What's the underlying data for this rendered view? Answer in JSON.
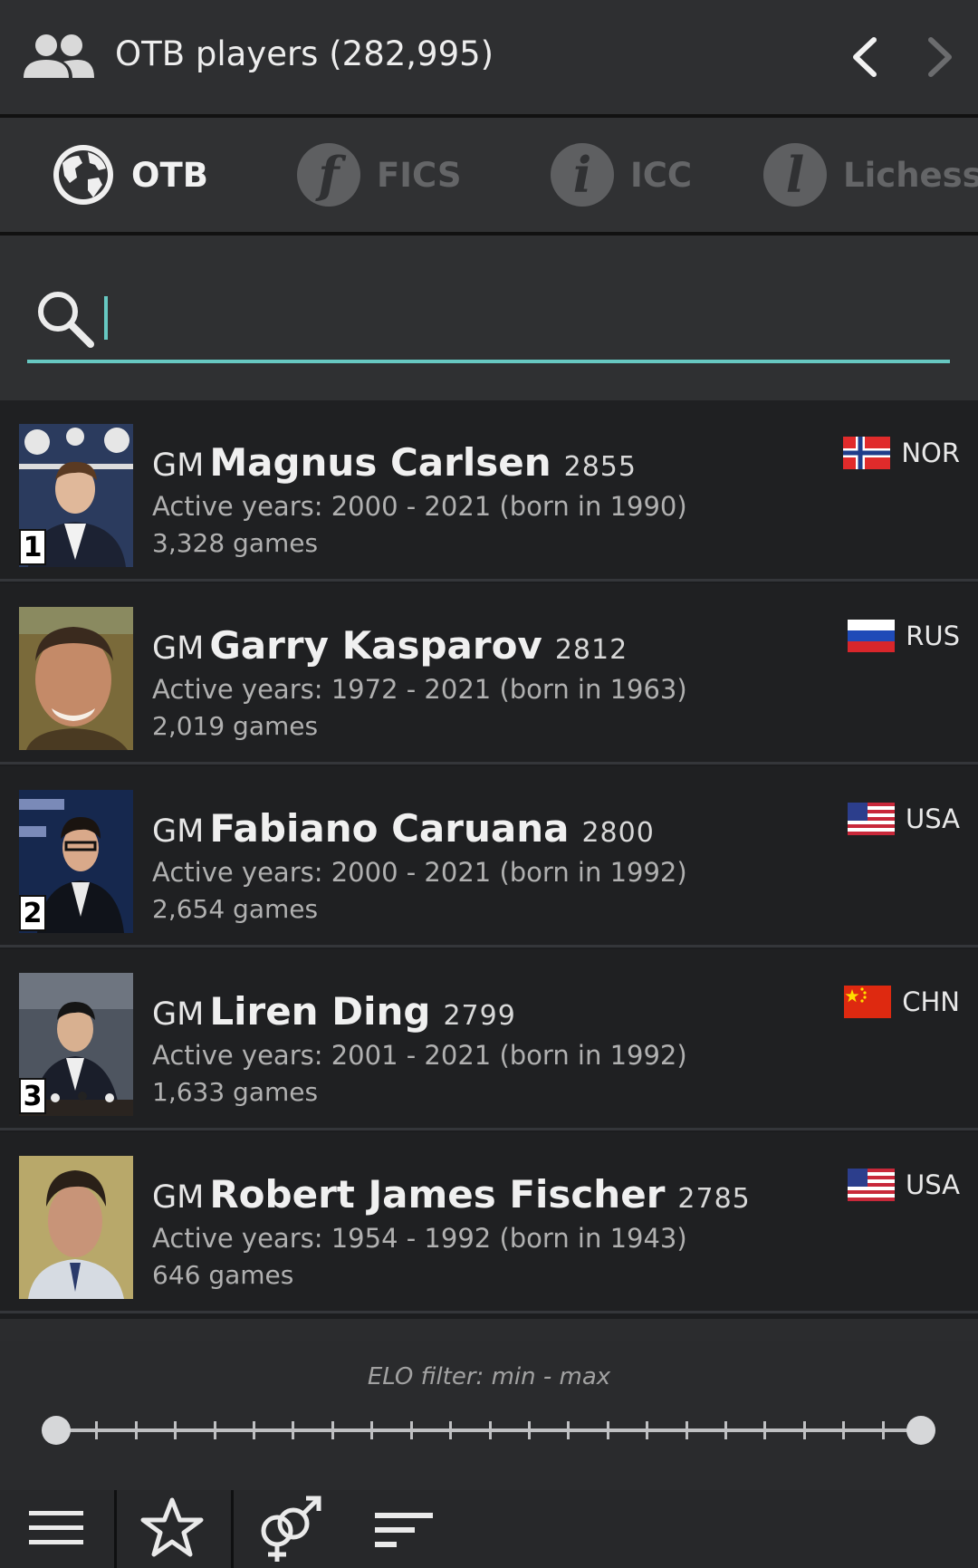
{
  "header": {
    "icon": "people-icon",
    "title": "OTB players (282,995)",
    "prev_icon": "chevron-left-icon",
    "next_icon": "chevron-right-icon"
  },
  "tabs": [
    {
      "label": "OTB",
      "icon": "globe-icon",
      "active": true
    },
    {
      "label": "FICS",
      "icon": "fics-icon",
      "active": false
    },
    {
      "label": "ICC",
      "icon": "icc-icon",
      "active": false
    },
    {
      "label": "Lichess",
      "icon": "lichess-icon",
      "active": false
    }
  ],
  "search": {
    "value": "",
    "placeholder": ""
  },
  "players": [
    {
      "title": "GM",
      "name": "Magnus Carlsen",
      "rating": "2855",
      "active": "Active years: 2000 - 2021 (born in 1990)",
      "games": "3,328 games",
      "rank": "1",
      "country": "NOR"
    },
    {
      "title": "GM",
      "name": "Garry Kasparov",
      "rating": "2812",
      "active": "Active years: 1972 - 2021 (born in 1963)",
      "games": "2,019 games",
      "rank": "",
      "country": "RUS"
    },
    {
      "title": "GM",
      "name": "Fabiano Caruana",
      "rating": "2800",
      "active": "Active years: 2000 - 2021 (born in 1992)",
      "games": "2,654 games",
      "rank": "2",
      "country": "USA"
    },
    {
      "title": "GM",
      "name": "Liren Ding",
      "rating": "2799",
      "active": "Active years: 2001 - 2021 (born in 1992)",
      "games": "1,633 games",
      "rank": "3",
      "country": "CHN"
    },
    {
      "title": "GM",
      "name": "Robert James Fischer",
      "rating": "2785",
      "active": "Active years: 1954 - 1992 (born in 1943)",
      "games": "646 games",
      "rank": "",
      "country": "USA"
    }
  ],
  "filter": {
    "label": "ELO filter: min - max",
    "min_fraction": 0.0,
    "max_fraction": 1.0
  },
  "bottom_bar": {
    "icons": [
      "menu-icon",
      "star-icon",
      "gender-icon",
      "sort-icon"
    ]
  },
  "colors": {
    "accent": "#67c8c2",
    "background": "#1f2022",
    "header": "#2e2f31"
  }
}
